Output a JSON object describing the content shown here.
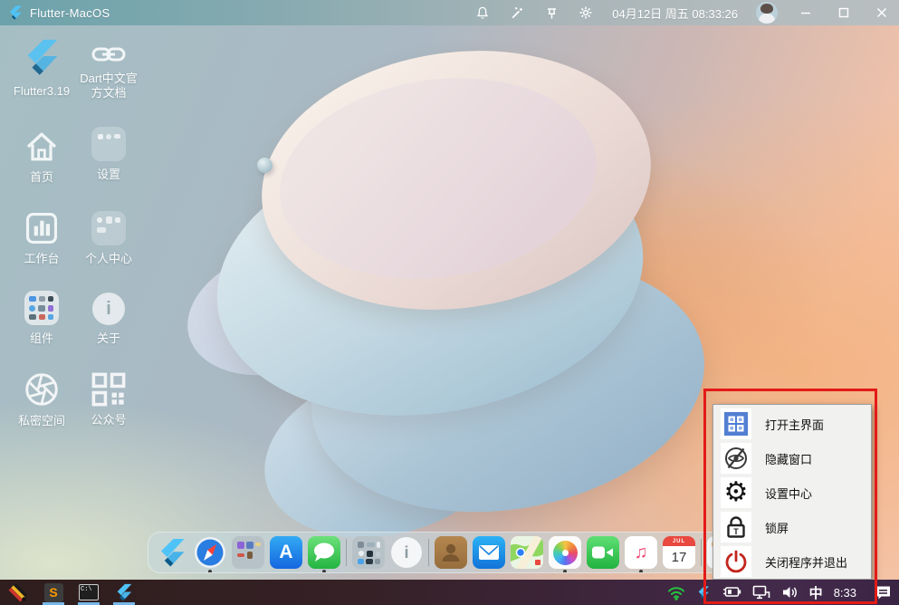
{
  "titlebar": {
    "title": "Flutter-MacOS",
    "datetime": "04月12日 周五 08:33:26"
  },
  "desktop": {
    "shortcuts": [
      {
        "label": "Flutter3.19",
        "icon": "flutter-logo"
      },
      {
        "label": "Dart中文官方文档",
        "icon": "link-icon"
      },
      {
        "label": "首页",
        "icon": "home-icon"
      },
      {
        "label": "设置",
        "icon": "settings-box-icon"
      },
      {
        "label": "工作台",
        "icon": "workbench-chart-icon"
      },
      {
        "label": "个人中心",
        "icon": "profile-box-icon"
      },
      {
        "label": "组件",
        "icon": "components-box-icon"
      },
      {
        "label": "关于",
        "icon": "info-circle-icon"
      },
      {
        "label": "私密空间",
        "icon": "aperture-icon"
      },
      {
        "label": "公众号",
        "icon": "qrcode-icon"
      }
    ]
  },
  "dock": {
    "items": [
      {
        "name": "flutter",
        "running": false
      },
      {
        "name": "safari",
        "running": true
      },
      {
        "name": "utilities-folder-a",
        "running": false
      },
      {
        "name": "app-store",
        "running": false
      },
      {
        "name": "messages",
        "running": true
      },
      {
        "name": "utilities-folder-b",
        "running": false
      },
      {
        "name": "about",
        "running": false
      },
      {
        "name": "contacts",
        "running": false
      },
      {
        "name": "mail",
        "running": false
      },
      {
        "name": "maps",
        "running": false
      },
      {
        "name": "photos",
        "running": true
      },
      {
        "name": "facetime",
        "running": false
      },
      {
        "name": "music",
        "running": true
      },
      {
        "name": "calendar",
        "running": false
      },
      {
        "name": "stickers",
        "running": false
      }
    ],
    "app_store_letter": "A",
    "about_letter": "i",
    "music_note": "♫",
    "calendar_month": "JUL",
    "calendar_day": "17"
  },
  "tray_menu": {
    "items": [
      {
        "label": "打开主界面",
        "icon": "main-ui-grid-icon"
      },
      {
        "label": "隐藏窗口",
        "icon": "hide-window-eye-off-icon"
      },
      {
        "label": "设置中心",
        "icon": "settings-gear-icon"
      },
      {
        "label": "锁屏",
        "icon": "lock-screen-icon"
      },
      {
        "label": "关闭程序并退出",
        "icon": "power-off-icon"
      }
    ],
    "gear_glyph": "⚙",
    "lock_letter": "T"
  },
  "taskbar": {
    "sublime_letter": "S",
    "cmd_label": "C:\\",
    "ime": "中",
    "time": "8:33"
  },
  "colors": {
    "annotation_red": "#e31b18",
    "menu_icon_blue": "#517fd2",
    "power_red": "#c2251c",
    "running_underline": "#77b7e9",
    "wifi_green": "#25c43f"
  }
}
